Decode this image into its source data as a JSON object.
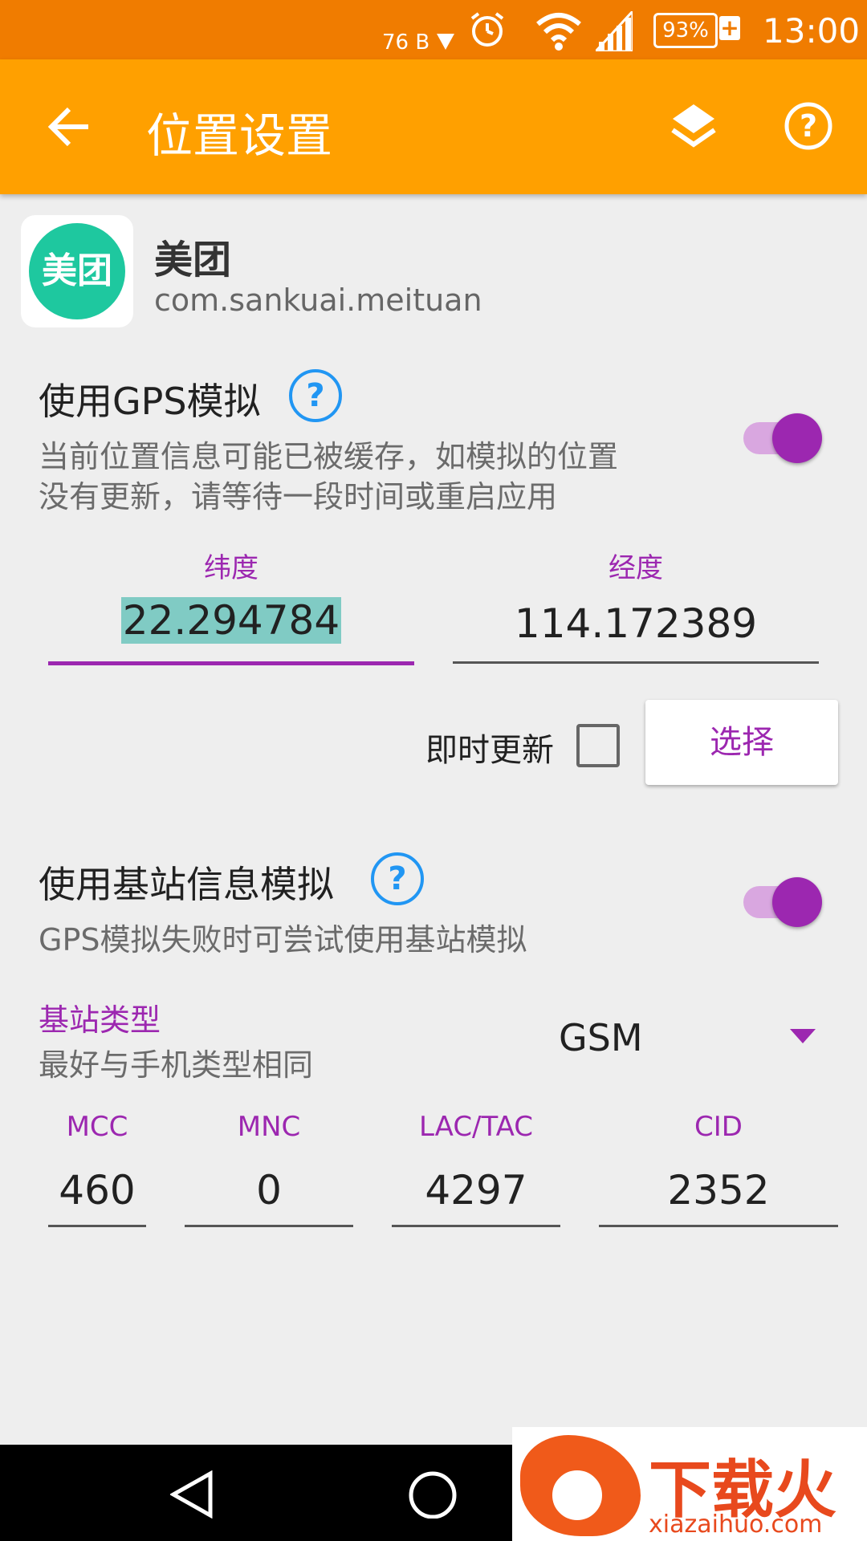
{
  "status_bar": {
    "net_speed": "76 B",
    "battery": "93%",
    "charging": "+",
    "time": "13:00"
  },
  "toolbar": {
    "title": "位置设置"
  },
  "app": {
    "icon_text": "美团",
    "name": "美团",
    "package": "com.sankuai.meituan"
  },
  "gps": {
    "title": "使用GPS模拟",
    "help": "?",
    "description_line1": "当前位置信息可能已被缓存，如模拟的位置",
    "description_line2": "没有更新，请等待一段时间或重启应用",
    "enabled": true,
    "latitude_label": "纬度",
    "latitude_value": "22.294784",
    "longitude_label": "经度",
    "longitude_value": "114.172389",
    "instant_update_label": "即时更新",
    "instant_update_checked": false,
    "select_button": "选择"
  },
  "cell": {
    "title": "使用基站信息模拟",
    "help": "?",
    "description": "GPS模拟失败时可尝试使用基站模拟",
    "enabled": true,
    "type_label": "基站类型",
    "type_hint": "最好与手机类型相同",
    "type_value": "GSM",
    "fields": [
      {
        "label": "MCC",
        "value": "460"
      },
      {
        "label": "MNC",
        "value": "0"
      },
      {
        "label": "LAC/TAC",
        "value": "4297"
      },
      {
        "label": "CID",
        "value": "2352"
      }
    ]
  },
  "watermark": {
    "text": "下载火",
    "url": "xiazaihuo.com"
  },
  "colors": {
    "status_bar": "#f07c00",
    "toolbar": "#ffa000",
    "accent": "#9c27b0",
    "help": "#2196f3",
    "selection": "#80cbc4"
  }
}
